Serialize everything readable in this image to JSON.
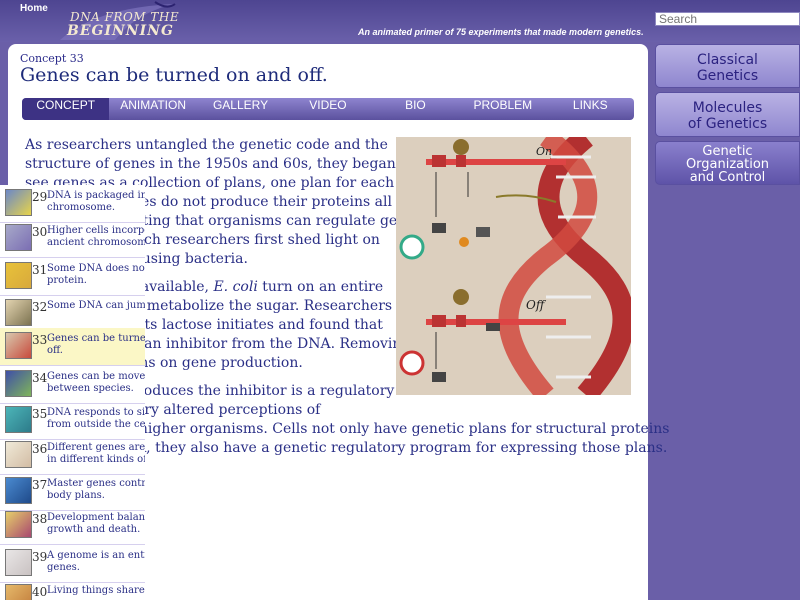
{
  "header": {
    "home_label": "Home",
    "logo_line1": "DNA FROM THE",
    "logo_line2": "BEGINNING",
    "tagline": "An animated primer of 75 experiments that made modern genetics.",
    "search_placeholder": "Search"
  },
  "concept": {
    "number_label": "Concept 33",
    "title": "Genes can be turned on and off."
  },
  "tabs": [
    "CONCEPT",
    "ANIMATION",
    "GALLERY",
    "VIDEO",
    "BIO",
    "PROBLEM",
    "LINKS"
  ],
  "active_tab": "CONCEPT",
  "body": {
    "p1": "As researchers untangled the genetic code and the\nstructure of genes in the 1950s and 60s, they began to\nsee genes as a collection of plans, one plan for each\nprotein. But genes do not produce their proteins all\nthe time, suggesting that organisms can regulate gene\nexpression. French researchers first shed light on\ngene regulation using bacteria.",
    "p2a": "When lactose is available, ",
    "p2_italic": "E. coli",
    "p2b": " turn on an entire\nsuite of genes to metabolize the sugar. Researchers\ntracked the events lactose initiates and found that\nlactose removes an inhibitor from the DNA. Removing\nthe inhibitor turns on gene production.",
    "p3": "The gene that produces the inhibitor is a regulatory\ngene. Its discovery altered perceptions of\ndevelopment in higher organisms. Cells not only have genetic plans for structural proteins\nwithin their DNA, they also have a genetic regulatory program for expressing those plans."
  },
  "figure": {
    "label_on": "On",
    "label_off": "Off"
  },
  "sidebar": {
    "sections": [
      {
        "line1": "Classical",
        "line2": "Genetics"
      },
      {
        "line1": "Molecules",
        "line2": "of Genetics"
      },
      {
        "line1": "Genetic",
        "line2": "Organization",
        "line3": "and Control"
      }
    ],
    "items": [
      {
        "num": "29",
        "text": "DNA is packaged in a\nchromosome."
      },
      {
        "num": "30",
        "text": "Higher cells incorporat\nancient chromosome."
      },
      {
        "num": "31",
        "text": "Some DNA does not en\nprotein."
      },
      {
        "num": "32",
        "text": "Some DNA can jump."
      },
      {
        "num": "33",
        "text": "Genes can be turned o\noff."
      },
      {
        "num": "34",
        "text": "Genes can be moved\nbetween species."
      },
      {
        "num": "35",
        "text": "DNA responds to signa\nfrom outside the cell."
      },
      {
        "num": "36",
        "text": "Different genes are act\nin different kinds of ce"
      },
      {
        "num": "37",
        "text": "Master genes control b\nbody plans."
      },
      {
        "num": "38",
        "text": "Development balances\ngrowth and death."
      },
      {
        "num": "39",
        "text": "A genome is an entire s\ngenes."
      },
      {
        "num": "40",
        "text": "Living things share"
      }
    ],
    "active_item": "33"
  },
  "colors": {
    "background": "#6a5fa8",
    "link_text": "#2a2f86",
    "active_item_bg": "#fbf7c6",
    "dna_red": "#c83a3a"
  }
}
